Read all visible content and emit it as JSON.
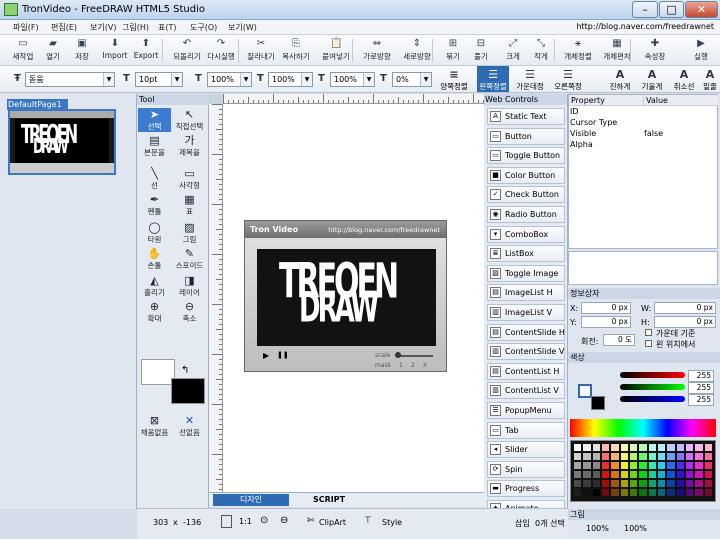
{
  "window": {
    "title": "TronVideo - FreeDRAW HTML5 Studio",
    "min_label": "–",
    "max_label": "□",
    "close_label": "✕"
  },
  "menu": {
    "items": [
      "파일(F)",
      "편집(E)",
      "보기(V)",
      "그림(H)",
      "표(T)",
      "도구(O)",
      "보기(W)"
    ],
    "url": "http://blog.naver.com/freedrawnet"
  },
  "toolbar1": [
    {
      "label": "새작업",
      "icon": "new-file-icon",
      "glyph": "▭"
    },
    {
      "label": "열기",
      "icon": "open-folder-icon",
      "glyph": "▰"
    },
    {
      "label": "저장",
      "icon": "save-icon",
      "glyph": "▣"
    },
    {
      "label": "Import",
      "icon": "import-icon",
      "glyph": "⬇"
    },
    {
      "label": "Export",
      "icon": "export-icon",
      "glyph": "⬆"
    },
    {
      "label": "되돌리기",
      "icon": "undo-icon",
      "glyph": "↶"
    },
    {
      "label": "다시실행",
      "icon": "redo-icon",
      "glyph": "↷"
    },
    {
      "label": "잘라내기",
      "icon": "cut-icon",
      "glyph": "✂"
    },
    {
      "label": "복사하기",
      "icon": "copy-icon",
      "glyph": "⎘"
    },
    {
      "label": "붙여넣기",
      "icon": "paste-icon",
      "glyph": "📋"
    },
    {
      "label": "가로방향",
      "icon": "horizontal-icon",
      "glyph": "⇔"
    },
    {
      "label": "세로방향",
      "icon": "vertical-icon",
      "glyph": "⇕"
    },
    {
      "label": "묶기",
      "icon": "group-icon",
      "glyph": "⊞"
    },
    {
      "label": "풀기",
      "icon": "ungroup-icon",
      "glyph": "⊟"
    },
    {
      "label": "크게",
      "icon": "zoom-in-icon",
      "glyph": "⤢"
    },
    {
      "label": "작게",
      "icon": "zoom-out-icon",
      "glyph": "⤡"
    },
    {
      "label": "개체정렬",
      "icon": "arrange-icon",
      "glyph": "⚹"
    },
    {
      "label": "개체편차",
      "icon": "distribute-icon",
      "glyph": "▦"
    },
    {
      "label": "속성창",
      "icon": "properties-icon",
      "glyph": "✚"
    },
    {
      "label": "실행",
      "icon": "run-icon",
      "glyph": "▶"
    }
  ],
  "toolbar2": {
    "font": "돋움",
    "font_size": "10pt",
    "scale_w": "100%",
    "scale_h": "100%",
    "scale_3": "100%",
    "rotate": "0%",
    "buttons": [
      {
        "label": "양쪽정렬",
        "icon": "justify-icon",
        "glyph": "≡"
      },
      {
        "label": "왼쪽정렬",
        "icon": "align-left-icon",
        "glyph": "☰"
      },
      {
        "label": "가운데정렬",
        "icon": "align-center-icon",
        "glyph": "☰"
      },
      {
        "label": "오른쪽정렬",
        "icon": "align-right-icon",
        "glyph": "☰"
      },
      {
        "label": "진하게",
        "icon": "bold-icon",
        "glyph": "A"
      },
      {
        "label": "기울게",
        "icon": "italic-icon",
        "glyph": "A"
      },
      {
        "label": "취소선",
        "icon": "strike-icon",
        "glyph": "A"
      },
      {
        "label": "밑줄",
        "icon": "underline-icon",
        "glyph": "A"
      }
    ]
  },
  "pages": {
    "name": "DefaultPage1"
  },
  "tools": {
    "header": "Tool",
    "items": [
      {
        "label": "선택",
        "icon": "arrow-select-icon",
        "glyph": "➤"
      },
      {
        "label": "직접선택",
        "icon": "direct-select-icon",
        "glyph": "↖"
      },
      {
        "label": "본문을",
        "icon": "text-box-icon",
        "glyph": "▤"
      },
      {
        "label": "제목을",
        "icon": "title-text-icon",
        "glyph": "가"
      },
      {
        "label": "선",
        "icon": "line-icon",
        "glyph": "╲"
      },
      {
        "label": "사각형",
        "icon": "rectangle-icon",
        "glyph": "▭"
      },
      {
        "label": "펜툴",
        "icon": "pen-icon",
        "glyph": "✒"
      },
      {
        "label": "표",
        "icon": "table-icon",
        "glyph": "▦"
      },
      {
        "label": "타원",
        "icon": "ellipse-icon",
        "glyph": "◯"
      },
      {
        "label": "그림",
        "icon": "image-icon",
        "glyph": "▨"
      },
      {
        "label": "손툴",
        "icon": "hand-icon",
        "glyph": "✋"
      },
      {
        "label": "스포이드",
        "icon": "eyedropper-icon",
        "glyph": "✎"
      },
      {
        "label": "흘리기",
        "icon": "gradient-icon",
        "glyph": "◭"
      },
      {
        "label": "레이어",
        "icon": "layer-icon",
        "glyph": "◨"
      },
      {
        "label": "확대",
        "icon": "magnify-plus-icon",
        "glyph": "⊕"
      },
      {
        "label": "축소",
        "icon": "magnify-minus-icon",
        "glyph": "⊖"
      }
    ],
    "swap_glyph": "↰",
    "fill_none": "채움없음",
    "line_none": "선없음"
  },
  "canvas": {
    "player_title": "Tron Video",
    "player_url": "http://blog.naver.com/freedrawnet",
    "logo_top": "TREOEN",
    "logo_bottom": "DRAW",
    "play_glyph": "▶",
    "pause_glyph": "❚❚",
    "scale_label": "scale",
    "mask_label": "mask",
    "mask_values": [
      "1",
      "2",
      "X"
    ]
  },
  "tabs": {
    "design": "디자인",
    "script": "SCRIPT"
  },
  "status": {
    "x": "303",
    "sep": "x",
    "y": "-136",
    "zoom": "1:1",
    "clipart": "ClipArt",
    "style": "Style",
    "mode": "삽입",
    "count": "0개 선택"
  },
  "webcontrols": {
    "header": "Web Controls",
    "items": [
      {
        "label": "Static Text",
        "glyph": "A"
      },
      {
        "label": "Button",
        "glyph": "▭"
      },
      {
        "label": "Toggle Button",
        "glyph": "▭"
      },
      {
        "label": "Color Button",
        "glyph": "■"
      },
      {
        "label": "Check Button",
        "glyph": "✓"
      },
      {
        "label": "Radio Button",
        "glyph": "◉"
      },
      {
        "label": "ComboBox",
        "glyph": "▾"
      },
      {
        "label": "ListBox",
        "glyph": "≣"
      },
      {
        "label": "Toggle Image",
        "glyph": "▨"
      },
      {
        "label": "ImageList H",
        "glyph": "▤"
      },
      {
        "label": "ImageList V",
        "glyph": "▥"
      },
      {
        "label": "ContentSlide H",
        "glyph": "▤"
      },
      {
        "label": "ContentSlide V",
        "glyph": "▥"
      },
      {
        "label": "ContentList H",
        "glyph": "▤"
      },
      {
        "label": "ContentList V",
        "glyph": "▥"
      },
      {
        "label": "PopupMenu",
        "glyph": "☰"
      },
      {
        "label": "Tab",
        "glyph": "▭"
      },
      {
        "label": "Slider",
        "glyph": "◂"
      },
      {
        "label": "Spin",
        "glyph": "⟳"
      },
      {
        "label": "Progress",
        "glyph": "▬"
      },
      {
        "label": "Animate",
        "glyph": "✦"
      }
    ]
  },
  "properties": {
    "col_property": "Property",
    "col_value": "Value",
    "rows": [
      {
        "name": "ID",
        "value": ""
      },
      {
        "name": "Cursor Type",
        "value": ""
      },
      {
        "name": "Visible",
        "value": "false"
      },
      {
        "name": "Alpha",
        "value": ""
      }
    ]
  },
  "position": {
    "header": "정보상자",
    "x_label": "X:",
    "x_value": "0 px",
    "y_label": "Y:",
    "y_value": "0 px",
    "w_label": "W:",
    "w_value": "0 px",
    "h_label": "H:",
    "h_value": "0 px",
    "rot_label": "회전:",
    "rot_value": "0 도",
    "opt1": "가운데 기준",
    "opt2": "왼 위치에서"
  },
  "color": {
    "header": "색상",
    "r": "255",
    "g": "255",
    "b": "255",
    "accent": "#2e6bb2"
  },
  "bottom_panel": {
    "header": "그림",
    "v1": "100%",
    "v2": "100%"
  }
}
